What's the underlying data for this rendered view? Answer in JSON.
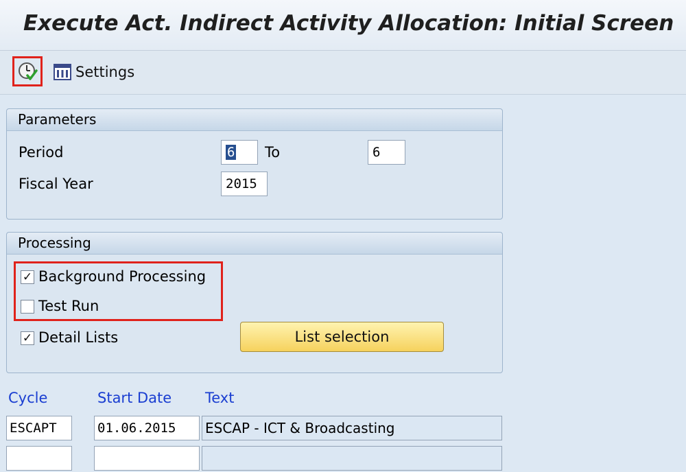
{
  "window": {
    "title": "Execute Act. Indirect Activity Allocation: Initial Screen"
  },
  "toolbar": {
    "execute_icon": "execute-clock-check-icon",
    "settings_icon": "columns-settings-icon",
    "settings_label": "Settings"
  },
  "parameters": {
    "header": "Parameters",
    "period_label": "Period",
    "period_from": "6",
    "to_label": "To",
    "period_to": "6",
    "fiscal_year_label": "Fiscal Year",
    "fiscal_year": "2015"
  },
  "processing": {
    "header": "Processing",
    "background_label": "Background Processing",
    "background_checked": true,
    "test_run_label": "Test Run",
    "test_run_checked": false,
    "detail_lists_label": "Detail Lists",
    "detail_lists_checked": true,
    "list_selection_label": "List selection"
  },
  "cycles": {
    "columns": [
      "Cycle",
      "Start Date",
      "Text"
    ],
    "rows": [
      {
        "cycle": "ESCAPT",
        "start_date": "01.06.2015",
        "text": "ESCAP - ICT & Broadcasting"
      },
      {
        "cycle": "",
        "start_date": "",
        "text": ""
      }
    ]
  },
  "colors": {
    "highlight": "#e0221b",
    "link_blue": "#1a3ed1",
    "button_yellow": "#f6d25d"
  }
}
